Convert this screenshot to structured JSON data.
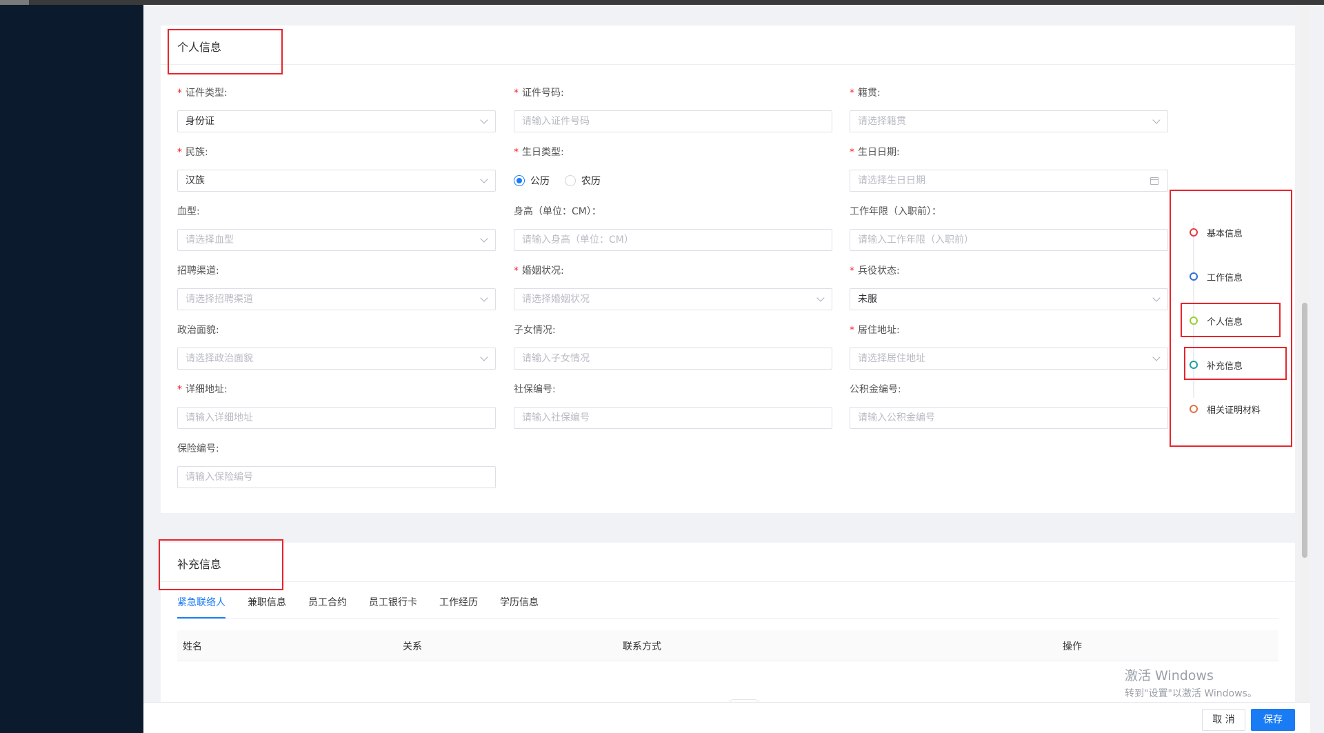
{
  "personal_section": {
    "title": "个人信息",
    "fields": {
      "id_type": {
        "label": "证件类型:",
        "required": true,
        "kind": "select",
        "value": "身份证",
        "placeholder": ""
      },
      "id_number": {
        "label": "证件号码:",
        "required": true,
        "kind": "input",
        "value": "",
        "placeholder": "请输入证件号码"
      },
      "native_place": {
        "label": "籍贯:",
        "required": true,
        "kind": "select",
        "value": "",
        "placeholder": "请选择籍贯"
      },
      "ethnicity": {
        "label": "民族:",
        "required": true,
        "kind": "select",
        "value": "汉族",
        "placeholder": ""
      },
      "birthday_type": {
        "label": "生日类型:",
        "required": true,
        "kind": "radio",
        "options": [
          "公历",
          "农历"
        ],
        "selected": "公历"
      },
      "birth_date": {
        "label": "生日日期:",
        "required": true,
        "kind": "date",
        "value": "",
        "placeholder": "请选择生日日期"
      },
      "blood_type": {
        "label": "血型:",
        "required": false,
        "kind": "select",
        "value": "",
        "placeholder": "请选择血型"
      },
      "height": {
        "label": "身高（单位：CM）：",
        "required": false,
        "kind": "input",
        "value": "",
        "placeholder": "请输入身高（单位：CM）"
      },
      "work_years": {
        "label": "工作年限（入职前）：",
        "required": false,
        "kind": "input",
        "value": "",
        "placeholder": "请输入工作年限（入职前）"
      },
      "recruit_channel": {
        "label": "招聘渠道:",
        "required": false,
        "kind": "select",
        "value": "",
        "placeholder": "请选择招聘渠道"
      },
      "marital_status": {
        "label": "婚姻状况:",
        "required": true,
        "kind": "select",
        "value": "",
        "placeholder": "请选择婚姻状况"
      },
      "military_status": {
        "label": "兵役状态:",
        "required": true,
        "kind": "select",
        "value": "未服",
        "placeholder": ""
      },
      "political_status": {
        "label": "政治面貌:",
        "required": false,
        "kind": "select",
        "value": "",
        "placeholder": "请选择政治面貌"
      },
      "children": {
        "label": "子女情况:",
        "required": false,
        "kind": "input",
        "value": "",
        "placeholder": "请输入子女情况"
      },
      "residence": {
        "label": "居住地址:",
        "required": true,
        "kind": "select",
        "value": "",
        "placeholder": "请选择居住地址"
      },
      "detail_address": {
        "label": "详细地址:",
        "required": true,
        "kind": "input",
        "value": "",
        "placeholder": "请输入详细地址"
      },
      "social_security": {
        "label": "社保编号:",
        "required": false,
        "kind": "input",
        "value": "",
        "placeholder": "请输入社保编号"
      },
      "housing_fund": {
        "label": "公积金编号:",
        "required": false,
        "kind": "input",
        "value": "",
        "placeholder": "请输入公积金编号"
      },
      "insurance": {
        "label": "保险编号:",
        "required": false,
        "kind": "input",
        "value": "",
        "placeholder": "请输入保险编号"
      }
    }
  },
  "anchor_nav": {
    "items": [
      {
        "label": "基本信息",
        "color": "#e8383d"
      },
      {
        "label": "工作信息",
        "color": "#2f6fd8"
      },
      {
        "label": "个人信息",
        "color": "#9acd32"
      },
      {
        "label": "补充信息",
        "color": "#20a0a0"
      },
      {
        "label": "相关证明材料",
        "color": "#e0704a"
      }
    ]
  },
  "supplement_section": {
    "title": "补充信息",
    "tabs": [
      "紧急联络人",
      "兼职信息",
      "员工合约",
      "员工银行卡",
      "工作经历",
      "学历信息"
    ],
    "active_tab": 0,
    "table_headers": [
      "姓名",
      "关系",
      "联系方式",
      "操作"
    ]
  },
  "watermark": {
    "line1": "激活 Windows",
    "line2": "转到\"设置\"以激活 Windows。"
  },
  "footer": {
    "cancel_label": "取 消",
    "save_label": "保存"
  }
}
